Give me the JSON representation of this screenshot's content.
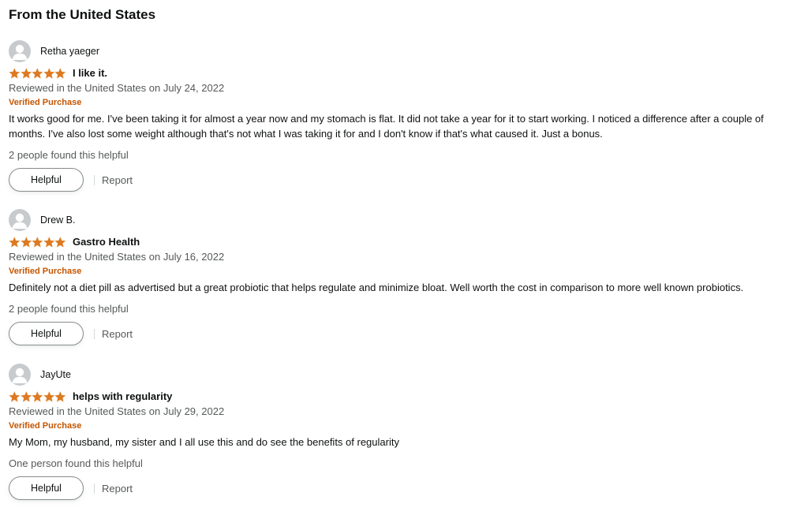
{
  "section": {
    "title": "From the United States"
  },
  "colors": {
    "star": "#de7921",
    "verified": "#c45500",
    "secondary_text": "#565959",
    "primary_text": "#0f1111"
  },
  "reviews": [
    {
      "profile_name": "Retha yaeger",
      "rating": 5,
      "title": "I like it.",
      "date": "Reviewed in the United States on July 24, 2022",
      "badge": "Verified Purchase",
      "body": "It works good for me. I've been taking it for almost a year now and my stomach is flat. It did not take a year for it to start working. I noticed a difference after a couple of months. I've also lost some weight although that's not what I was taking it for and I don't know if that's what caused it. Just a bonus.",
      "helpful_count": "2 people found this helpful",
      "helpful_label": "Helpful",
      "report_label": "Report"
    },
    {
      "profile_name": "Drew B.",
      "rating": 5,
      "title": "Gastro Health",
      "date": "Reviewed in the United States on July 16, 2022",
      "badge": "Verified Purchase",
      "body": "Definitely not a diet pill as advertised but a great probiotic that helps regulate and minimize bloat. Well worth the cost in comparison to more well known probiotics.",
      "helpful_count": "2 people found this helpful",
      "helpful_label": "Helpful",
      "report_label": "Report"
    },
    {
      "profile_name": "JayUte",
      "rating": 5,
      "title": "helps with regularity",
      "date": "Reviewed in the United States on July 29, 2022",
      "badge": "Verified Purchase",
      "body": "My Mom, my husband, my sister and I all use this and do see the benefits of regularity",
      "helpful_count": "One person found this helpful",
      "helpful_label": "Helpful",
      "report_label": "Report"
    }
  ]
}
